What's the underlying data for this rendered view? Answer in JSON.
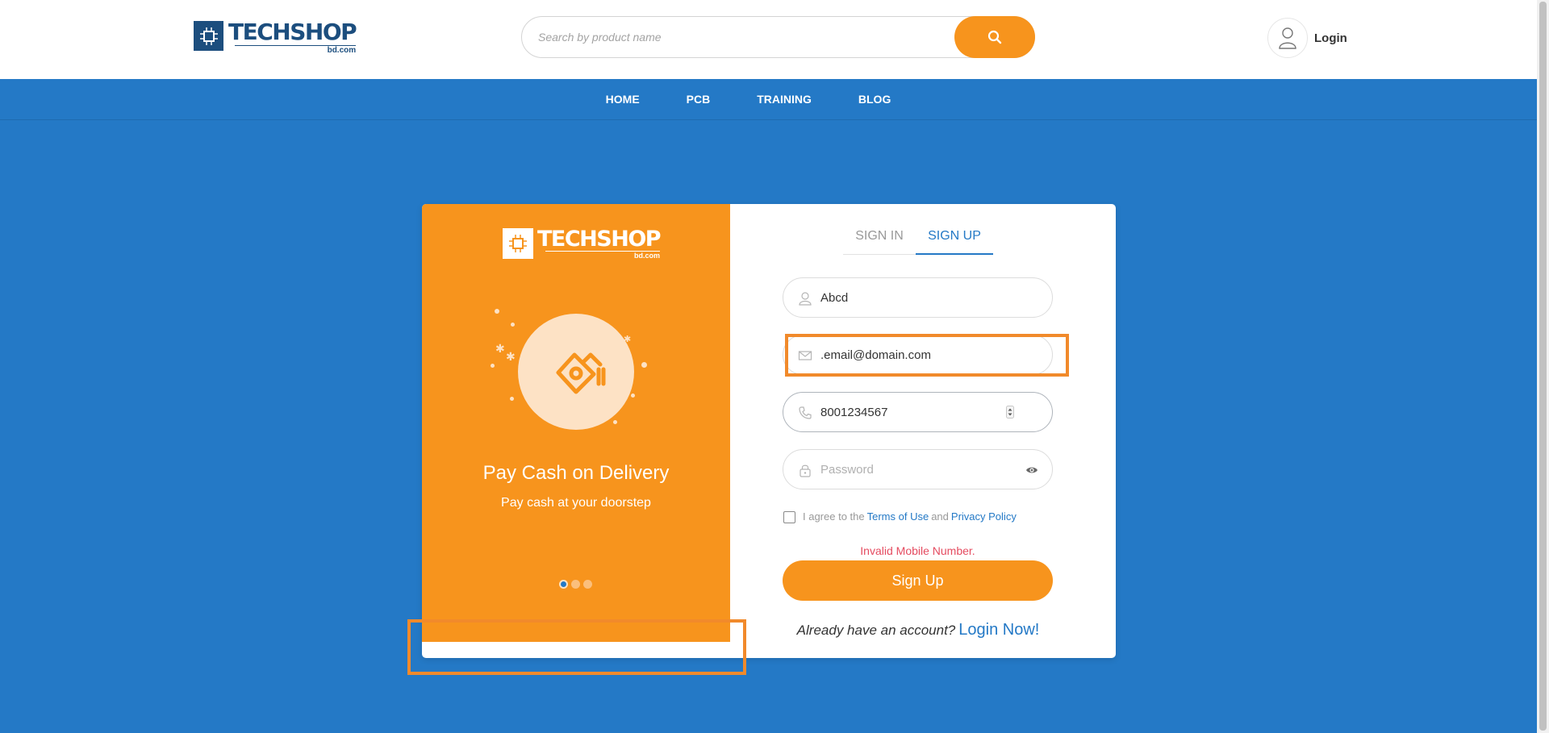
{
  "header": {
    "logo": {
      "word_a": "TECH",
      "word_b": "SHOP",
      "sub": "bd.com"
    },
    "search": {
      "placeholder": "Search by product name",
      "value": ""
    },
    "login_label": "Login"
  },
  "nav": {
    "items": [
      "HOME",
      "PCB",
      "TRAINING",
      "BLOG"
    ]
  },
  "promo": {
    "logo": {
      "word": "TECHSHOP",
      "sub": "bd.com"
    },
    "title": "Pay Cash on Delivery",
    "subtitle": "Pay cash at your doorstep",
    "slide_count": 3,
    "active_slide": 1
  },
  "form": {
    "tabs": {
      "signin": "SIGN IN",
      "signup": "SIGN UP",
      "active": "SIGN UP"
    },
    "name": {
      "value": "Abcd",
      "placeholder": ""
    },
    "email": {
      "value": ".email@domain.com",
      "placeholder": ""
    },
    "phone": {
      "value": "8001234567",
      "placeholder": ""
    },
    "password": {
      "value": "",
      "placeholder": "Password"
    },
    "agree": {
      "prefix": "I agree to the",
      "terms": "Terms of Use",
      "and": "and",
      "privacy": "Privacy Policy",
      "checked": false
    },
    "error": "Invalid Mobile Number.",
    "submit_label": "Sign Up",
    "already_text": "Already have an account?",
    "login_now": "Login Now!"
  },
  "colors": {
    "brand_blue": "#2479c6",
    "brand_orange": "#f7941d",
    "error": "#e54b5f"
  },
  "icons": [
    "search-icon",
    "user-icon",
    "mail-icon",
    "phone-icon",
    "lock-icon",
    "eye-icon",
    "money-hand-icon"
  ]
}
